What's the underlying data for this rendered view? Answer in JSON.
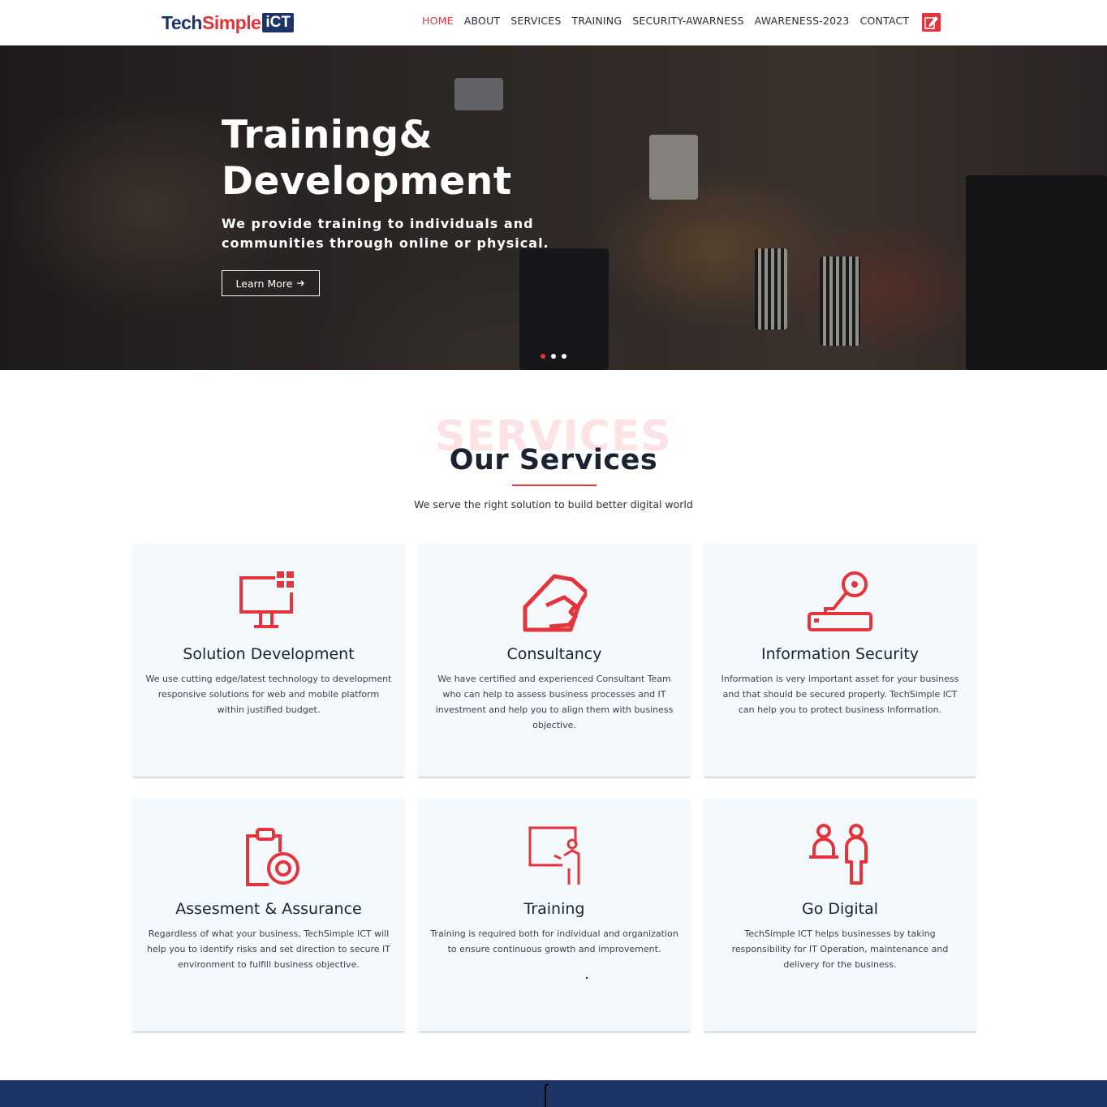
{
  "brand": {
    "part1": "Tech",
    "part2": "Simple",
    "part3": "iCT",
    "colors": {
      "navy": "#1d3468",
      "red": "#e53238"
    }
  },
  "nav": {
    "items": [
      {
        "label": "HOME",
        "active": true
      },
      {
        "label": "ABOUT"
      },
      {
        "label": "SERVICES"
      },
      {
        "label": "TRAINING"
      },
      {
        "label": "SECURITY-AWARNESS"
      },
      {
        "label": "AWARENESS-2023"
      },
      {
        "label": "CONTACT"
      }
    ],
    "edit_icon": "edit-icon"
  },
  "hero": {
    "title_line1": "Training&",
    "title_line2": "Development",
    "subtitle": "We provide training to individuals and communities through online or physical.",
    "button_label": "Learn More",
    "button_icon": "arrow-right-icon",
    "slides": 3,
    "active_slide": 1
  },
  "services": {
    "bg_word": "SERVICES",
    "title": "Our Services",
    "subtitle": "We serve the right solution to build better digital world",
    "cards": [
      {
        "icon": "monitor-icon",
        "title": "Solution Development",
        "desc": "We use cutting edge/latest technology to development responsive solutions for web and mobile platform within justified budget."
      },
      {
        "icon": "handshake-house-icon",
        "title": "Consultancy",
        "desc": "We have certified and experienced Consultant Team who can help to assess business processes and IT investment and help you to align them with business objective."
      },
      {
        "icon": "key-lock-icon",
        "title": "Information Security",
        "desc": "Information is very important asset for your business and that should be secured properly. TechSimple ICT can help you to protect business Information."
      },
      {
        "icon": "clipboard-target-icon",
        "title": "Assesment & Assurance",
        "desc": "Regardless of what your business, TechSimple ICT will help you to identify risks and set direction to secure IT environment to fulfill business objective."
      },
      {
        "icon": "presentation-icon",
        "title": "Training",
        "desc": "Training is required both for individual and organization to ensure continuous growth and improvement.",
        "trailing": "."
      },
      {
        "icon": "people-icon",
        "title": "Go Digital",
        "desc": "TechSimple ICT helps businesses by taking responsibility for IT Operation, maintenance and delivery for the business."
      }
    ]
  }
}
